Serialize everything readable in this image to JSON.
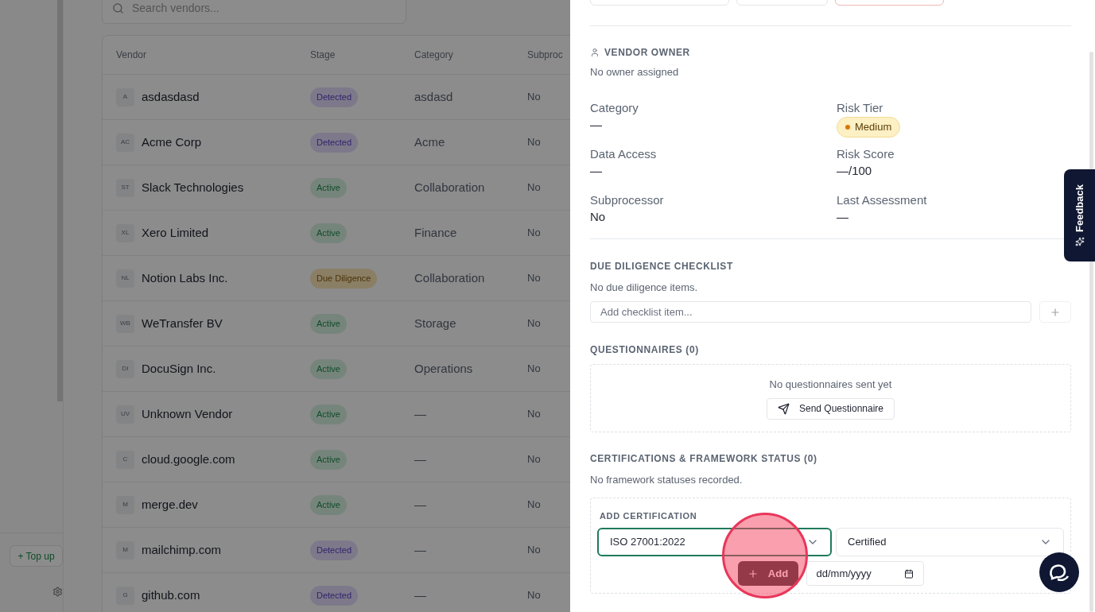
{
  "sidebar": {
    "top_up_button": "+ Top up"
  },
  "search": {
    "placeholder": "Search vendors..."
  },
  "table": {
    "columns": [
      "Vendor",
      "Stage",
      "Category",
      "Subproc"
    ],
    "rows": [
      {
        "initials": "A",
        "vendor": "asdasdasd",
        "stage": {
          "label": "Detected",
          "kind": "detected"
        },
        "category": "asdasd",
        "subprocessor": "No"
      },
      {
        "initials": "AC",
        "vendor": "Acme Corp",
        "stage": {
          "label": "Detected",
          "kind": "detected"
        },
        "category": "Acme",
        "subprocessor": "No"
      },
      {
        "initials": "ST",
        "vendor": "Slack Technologies",
        "stage": {
          "label": "Active",
          "kind": "active"
        },
        "category": "Collaboration",
        "subprocessor": "No"
      },
      {
        "initials": "XL",
        "vendor": "Xero Limited",
        "stage": {
          "label": "Active",
          "kind": "active"
        },
        "category": "Finance",
        "subprocessor": "No"
      },
      {
        "initials": "NL",
        "vendor": "Notion Labs Inc.",
        "stage": {
          "label": "Due Diligence",
          "kind": "due_diligence"
        },
        "category": "Collaboration",
        "subprocessor": "No"
      },
      {
        "initials": "WB",
        "vendor": "WeTransfer BV",
        "stage": {
          "label": "Active",
          "kind": "active"
        },
        "category": "Storage",
        "subprocessor": "No"
      },
      {
        "initials": "DI",
        "vendor": "DocuSign Inc.",
        "stage": {
          "label": "Active",
          "kind": "active"
        },
        "category": "Operations",
        "subprocessor": "No"
      },
      {
        "initials": "UV",
        "vendor": "Unknown Vendor",
        "stage": {
          "label": "Active",
          "kind": "active"
        },
        "category": "—",
        "subprocessor": "No"
      },
      {
        "initials": "C",
        "vendor": "cloud.google.com",
        "stage": {
          "label": "Active",
          "kind": "active"
        },
        "category": "—",
        "subprocessor": "No"
      },
      {
        "initials": "M",
        "vendor": "merge.dev",
        "stage": {
          "label": "Active",
          "kind": "active"
        },
        "category": "—",
        "subprocessor": "No"
      },
      {
        "initials": "M",
        "vendor": "mailchimp.com",
        "stage": {
          "label": "Detected",
          "kind": "detected"
        },
        "category": "—",
        "subprocessor": "No"
      },
      {
        "initials": "G",
        "vendor": "github.com",
        "stage": {
          "label": "Detected",
          "kind": "detected"
        },
        "category": "—",
        "subprocessor": "No"
      }
    ]
  },
  "drawer": {
    "vendor_owner": {
      "heading": "VENDOR OWNER",
      "value": "No owner assigned"
    },
    "fields": [
      {
        "label": "Category",
        "value": "—",
        "kind": "text"
      },
      {
        "label": "Risk Tier",
        "value": "Medium",
        "kind": "badge",
        "color": "#d97706"
      },
      {
        "label": "Data Access",
        "value": "—",
        "kind": "text"
      },
      {
        "label": "Risk Score",
        "value": "—/100",
        "kind": "text"
      },
      {
        "label": "Subprocessor",
        "value": "No",
        "kind": "text"
      },
      {
        "label": "Last Assessment",
        "value": "—",
        "kind": "text"
      }
    ],
    "due_diligence": {
      "heading": "DUE DILIGENCE CHECKLIST",
      "empty": "No due diligence items.",
      "placeholder": "Add checklist item..."
    },
    "questionnaires": {
      "heading": "QUESTIONNAIRES (0)",
      "empty": "No questionnaires sent yet",
      "button": "Send Questionnaire"
    },
    "certifications": {
      "heading": "CERTIFICATIONS & FRAMEWORK STATUS (0)",
      "empty": "No framework statuses recorded.",
      "form_heading": "ADD CERTIFICATION",
      "framework": {
        "value": "ISO 27001:2022",
        "focused": true
      },
      "status": {
        "value": "Certified",
        "focused": false
      },
      "add_button": "Add",
      "date_placeholder": "dd/mm/yyyy"
    }
  },
  "feedback_tab": "Feedback"
}
